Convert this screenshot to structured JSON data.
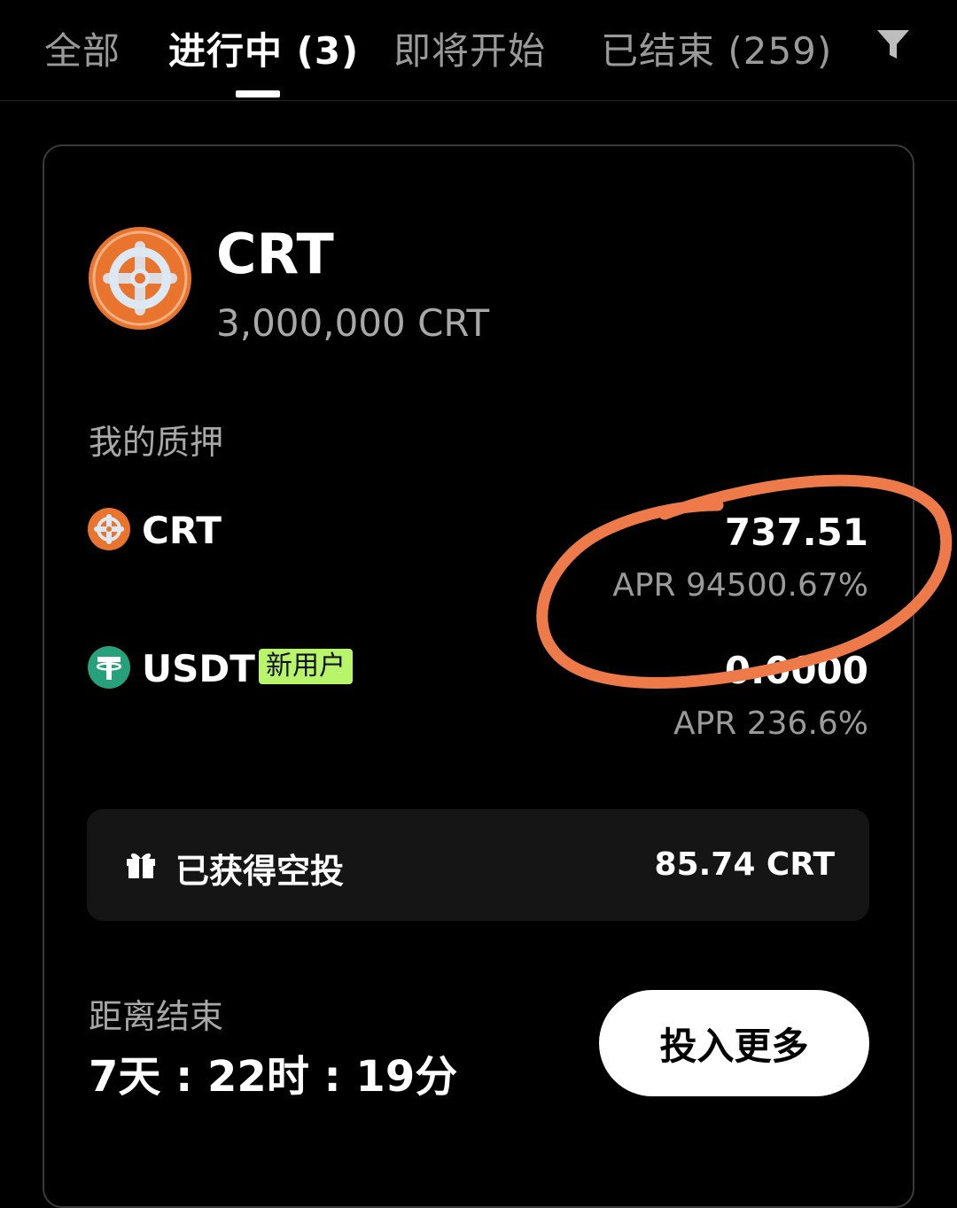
{
  "tabs": [
    {
      "label": "全部"
    },
    {
      "label": "进行中 (3)"
    },
    {
      "label": "即将开始"
    },
    {
      "label": "已结束 (259)"
    }
  ],
  "filter_icon": "filter-funnel-icon",
  "card": {
    "token_name": "CRT",
    "token_supply": "3,000,000 CRT",
    "my_stake_label": "我的质押",
    "assets": [
      {
        "name": "CRT",
        "amount": "737.51",
        "apr": "APR 94500.67%",
        "icon": "crt-token-icon"
      },
      {
        "name": "USDT",
        "badge": "新用户",
        "amount": "0.0000",
        "apr": "APR 236.6%",
        "icon": "tether-icon"
      }
    ],
    "airdrop": {
      "label": "已获得空投",
      "value": "85.74 CRT",
      "icon": "gift-icon"
    },
    "countdown": {
      "label": "距离结束",
      "value": "7天 : 22时 : 19分"
    },
    "invest_more_label": "投入更多"
  },
  "colors": {
    "background": "#000000",
    "badge_green": "#b8f56a",
    "annotation_orange": "#ee7a4a",
    "crt_orange": "#e8742e",
    "tether_green": "#26a17b"
  }
}
